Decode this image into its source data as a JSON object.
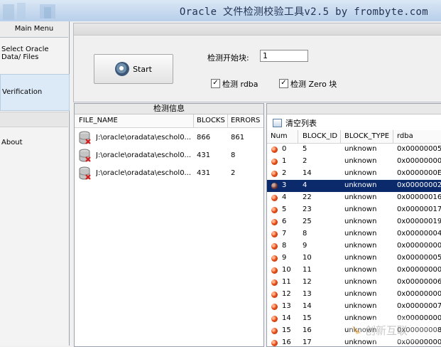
{
  "window": {
    "title": "Oracle 文件检测校验工具v2.5 by frombyte.com"
  },
  "sidebar": {
    "header": "Main Menu",
    "items": [
      {
        "label": "Select Oracle Data/ Files",
        "selected": false
      },
      {
        "label": "Verification",
        "selected": true
      },
      {
        "label": "About",
        "selected": false
      }
    ]
  },
  "controls": {
    "start_label": "Start",
    "start_block_label": "检测开始块:",
    "start_block_value": "1",
    "check_rdba_label": "检测 rdba",
    "check_rdba_checked": true,
    "check_zero_label": "检测 Zero 块",
    "check_zero_checked": true
  },
  "detect_panel": {
    "title": "检测信息",
    "columns": [
      "FILE_NAME",
      "BLOCKS",
      "ERRORS"
    ],
    "rows": [
      {
        "file": "J:\\oracle\\oradata\\eschol0...",
        "blocks": "866",
        "errors": "861"
      },
      {
        "file": "J:\\oracle\\oradata\\eschol0...",
        "blocks": "431",
        "errors": "8"
      },
      {
        "file": "J:\\oracle\\oradata\\eschol0...",
        "blocks": "431",
        "errors": "2"
      }
    ]
  },
  "result_panel": {
    "clear_label": "清空列表",
    "columns": [
      "Num",
      "BLOCK_ID",
      "BLOCK_TYPE",
      "rdba"
    ],
    "selected_index": 3,
    "rows": [
      {
        "num": "0",
        "block_id": "5",
        "type": "unknown",
        "rdba": "0x00000005"
      },
      {
        "num": "1",
        "block_id": "2",
        "type": "unknown",
        "rdba": "0x00000000"
      },
      {
        "num": "2",
        "block_id": "14",
        "type": "unknown",
        "rdba": "0x0000000E"
      },
      {
        "num": "3",
        "block_id": "4",
        "type": "unknown",
        "rdba": "0x00000002"
      },
      {
        "num": "4",
        "block_id": "22",
        "type": "unknown",
        "rdba": "0x00000016"
      },
      {
        "num": "5",
        "block_id": "23",
        "type": "unknown",
        "rdba": "0x00000017"
      },
      {
        "num": "6",
        "block_id": "25",
        "type": "unknown",
        "rdba": "0x00000019"
      },
      {
        "num": "7",
        "block_id": "8",
        "type": "unknown",
        "rdba": "0x00000004"
      },
      {
        "num": "8",
        "block_id": "9",
        "type": "unknown",
        "rdba": "0x00000000"
      },
      {
        "num": "9",
        "block_id": "10",
        "type": "unknown",
        "rdba": "0x00000005"
      },
      {
        "num": "10",
        "block_id": "11",
        "type": "unknown",
        "rdba": "0x00000000"
      },
      {
        "num": "11",
        "block_id": "12",
        "type": "unknown",
        "rdba": "0x00000006"
      },
      {
        "num": "12",
        "block_id": "13",
        "type": "unknown",
        "rdba": "0x00000000"
      },
      {
        "num": "13",
        "block_id": "14",
        "type": "unknown",
        "rdba": "0x00000007"
      },
      {
        "num": "14",
        "block_id": "15",
        "type": "unknown",
        "rdba": "0x00000000"
      },
      {
        "num": "15",
        "block_id": "16",
        "type": "unknown",
        "rdba": "0x00000008"
      },
      {
        "num": "16",
        "block_id": "17",
        "type": "unknown",
        "rdba": "0x00000000"
      }
    ]
  },
  "watermark": {
    "text": "创新互联"
  },
  "colors": {
    "selection": "#0b2a6b",
    "titlebar": "#c5d8ee",
    "status_dot": "#e8501a"
  }
}
